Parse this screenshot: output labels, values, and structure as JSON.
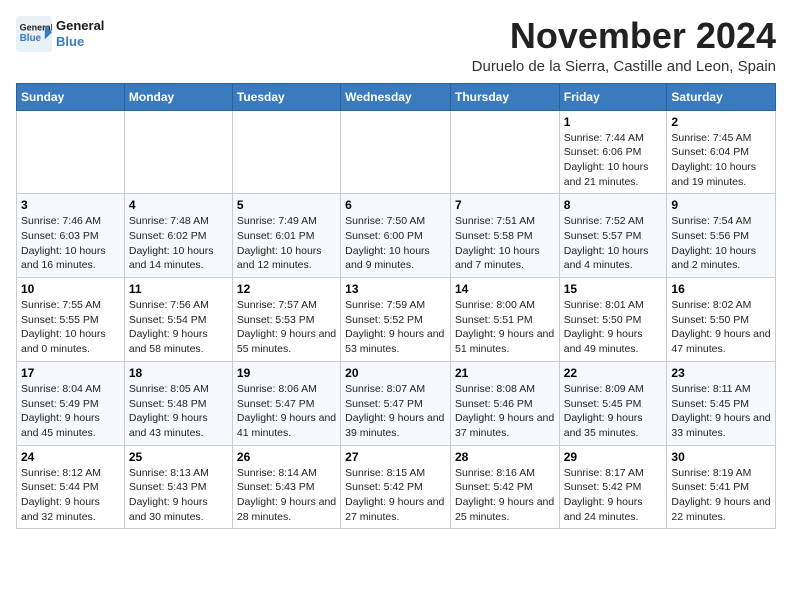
{
  "logo": {
    "line1": "General",
    "line2": "Blue"
  },
  "header": {
    "title": "November 2024",
    "subtitle": "Duruelo de la Sierra, Castille and Leon, Spain"
  },
  "weekdays": [
    "Sunday",
    "Monday",
    "Tuesday",
    "Wednesday",
    "Thursday",
    "Friday",
    "Saturday"
  ],
  "weeks": [
    [
      {
        "day": "",
        "info": ""
      },
      {
        "day": "",
        "info": ""
      },
      {
        "day": "",
        "info": ""
      },
      {
        "day": "",
        "info": ""
      },
      {
        "day": "",
        "info": ""
      },
      {
        "day": "1",
        "info": "Sunrise: 7:44 AM\nSunset: 6:06 PM\nDaylight: 10 hours and 21 minutes."
      },
      {
        "day": "2",
        "info": "Sunrise: 7:45 AM\nSunset: 6:04 PM\nDaylight: 10 hours and 19 minutes."
      }
    ],
    [
      {
        "day": "3",
        "info": "Sunrise: 7:46 AM\nSunset: 6:03 PM\nDaylight: 10 hours and 16 minutes."
      },
      {
        "day": "4",
        "info": "Sunrise: 7:48 AM\nSunset: 6:02 PM\nDaylight: 10 hours and 14 minutes."
      },
      {
        "day": "5",
        "info": "Sunrise: 7:49 AM\nSunset: 6:01 PM\nDaylight: 10 hours and 12 minutes."
      },
      {
        "day": "6",
        "info": "Sunrise: 7:50 AM\nSunset: 6:00 PM\nDaylight: 10 hours and 9 minutes."
      },
      {
        "day": "7",
        "info": "Sunrise: 7:51 AM\nSunset: 5:58 PM\nDaylight: 10 hours and 7 minutes."
      },
      {
        "day": "8",
        "info": "Sunrise: 7:52 AM\nSunset: 5:57 PM\nDaylight: 10 hours and 4 minutes."
      },
      {
        "day": "9",
        "info": "Sunrise: 7:54 AM\nSunset: 5:56 PM\nDaylight: 10 hours and 2 minutes."
      }
    ],
    [
      {
        "day": "10",
        "info": "Sunrise: 7:55 AM\nSunset: 5:55 PM\nDaylight: 10 hours and 0 minutes."
      },
      {
        "day": "11",
        "info": "Sunrise: 7:56 AM\nSunset: 5:54 PM\nDaylight: 9 hours and 58 minutes."
      },
      {
        "day": "12",
        "info": "Sunrise: 7:57 AM\nSunset: 5:53 PM\nDaylight: 9 hours and 55 minutes."
      },
      {
        "day": "13",
        "info": "Sunrise: 7:59 AM\nSunset: 5:52 PM\nDaylight: 9 hours and 53 minutes."
      },
      {
        "day": "14",
        "info": "Sunrise: 8:00 AM\nSunset: 5:51 PM\nDaylight: 9 hours and 51 minutes."
      },
      {
        "day": "15",
        "info": "Sunrise: 8:01 AM\nSunset: 5:50 PM\nDaylight: 9 hours and 49 minutes."
      },
      {
        "day": "16",
        "info": "Sunrise: 8:02 AM\nSunset: 5:50 PM\nDaylight: 9 hours and 47 minutes."
      }
    ],
    [
      {
        "day": "17",
        "info": "Sunrise: 8:04 AM\nSunset: 5:49 PM\nDaylight: 9 hours and 45 minutes."
      },
      {
        "day": "18",
        "info": "Sunrise: 8:05 AM\nSunset: 5:48 PM\nDaylight: 9 hours and 43 minutes."
      },
      {
        "day": "19",
        "info": "Sunrise: 8:06 AM\nSunset: 5:47 PM\nDaylight: 9 hours and 41 minutes."
      },
      {
        "day": "20",
        "info": "Sunrise: 8:07 AM\nSunset: 5:47 PM\nDaylight: 9 hours and 39 minutes."
      },
      {
        "day": "21",
        "info": "Sunrise: 8:08 AM\nSunset: 5:46 PM\nDaylight: 9 hours and 37 minutes."
      },
      {
        "day": "22",
        "info": "Sunrise: 8:09 AM\nSunset: 5:45 PM\nDaylight: 9 hours and 35 minutes."
      },
      {
        "day": "23",
        "info": "Sunrise: 8:11 AM\nSunset: 5:45 PM\nDaylight: 9 hours and 33 minutes."
      }
    ],
    [
      {
        "day": "24",
        "info": "Sunrise: 8:12 AM\nSunset: 5:44 PM\nDaylight: 9 hours and 32 minutes."
      },
      {
        "day": "25",
        "info": "Sunrise: 8:13 AM\nSunset: 5:43 PM\nDaylight: 9 hours and 30 minutes."
      },
      {
        "day": "26",
        "info": "Sunrise: 8:14 AM\nSunset: 5:43 PM\nDaylight: 9 hours and 28 minutes."
      },
      {
        "day": "27",
        "info": "Sunrise: 8:15 AM\nSunset: 5:42 PM\nDaylight: 9 hours and 27 minutes."
      },
      {
        "day": "28",
        "info": "Sunrise: 8:16 AM\nSunset: 5:42 PM\nDaylight: 9 hours and 25 minutes."
      },
      {
        "day": "29",
        "info": "Sunrise: 8:17 AM\nSunset: 5:42 PM\nDaylight: 9 hours and 24 minutes."
      },
      {
        "day": "30",
        "info": "Sunrise: 8:19 AM\nSunset: 5:41 PM\nDaylight: 9 hours and 22 minutes."
      }
    ]
  ]
}
